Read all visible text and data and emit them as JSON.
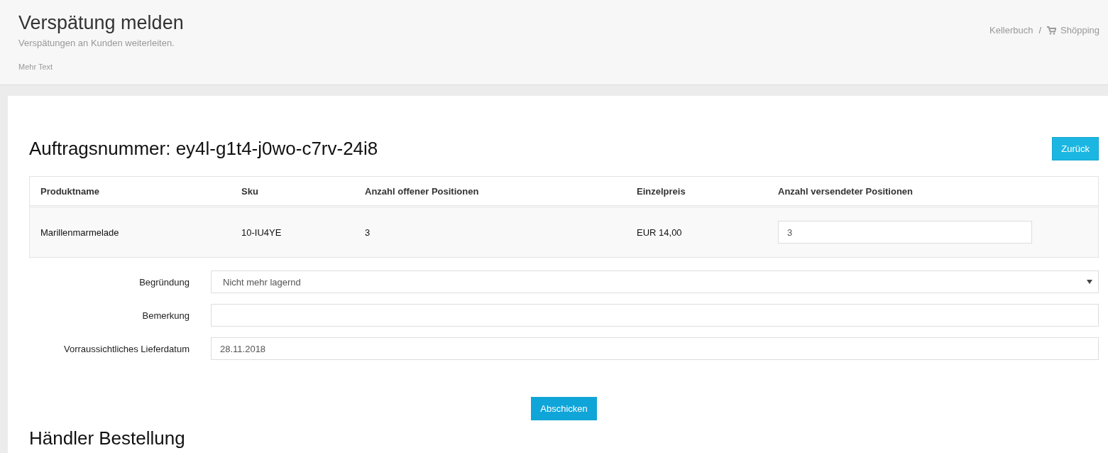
{
  "header": {
    "title": "Verspätung melden",
    "subtitle": "Verspätungen an Kunden weiterleiten.",
    "more": "Mehr Text",
    "breadcrumb": [
      "Kellerbuch",
      "Shöpping"
    ],
    "breadcrumb_separator": "/"
  },
  "order": {
    "title": "Auftragsnummer: ey4l-g1t4-j0wo-c7rv-24i8",
    "back_button": "Zurück"
  },
  "table": {
    "columns": [
      "Produktname",
      "Sku",
      "Anzahl offener Positionen",
      "Einzelpreis",
      "Anzahl versendeter Positionen"
    ],
    "rows": [
      {
        "cells": [
          "Marillenmarmelade",
          "10-IU4YE",
          "3",
          "EUR 14,00"
        ],
        "input_value": "3"
      }
    ]
  },
  "form": [
    {
      "kind": "select",
      "label": "Begründung",
      "value": "Nicht mehr lagernd"
    },
    {
      "kind": "text",
      "label": "Bemerkung"
    },
    {
      "kind": "text",
      "label": "Vorraussichtliches Lieferdatum",
      "value": "28.11.2018"
    }
  ],
  "submit_button": "Abschicken",
  "next_section_title": "Händler Bestellung"
}
